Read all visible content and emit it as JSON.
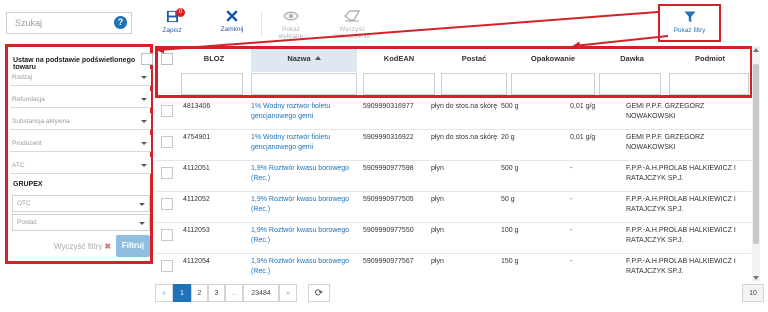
{
  "search": {
    "placeholder": "Szukaj",
    "help": "?"
  },
  "filter_panel": {
    "title": "Ustaw na podstawie podświetlonego towaru",
    "selects": [
      "Rodzaj",
      "Refundacja",
      "Substancja aktywna",
      "Producent",
      "ATC"
    ],
    "group_title": "GRUPEX",
    "group_selects": [
      "OTC",
      "Postać"
    ],
    "clear_label": "Wyczyść filtry",
    "clear_icon": "✖",
    "filter_label": "Filtruj"
  },
  "toolbar": {
    "save_label": "Zapisz",
    "save_badge": "0",
    "close_label": "Zamknij",
    "show_selected_label": "Pokaż wybrane",
    "clear_selection_label": "Wyczyść zaznaczenie",
    "show_filters_label": "Pokaż filtry"
  },
  "table": {
    "columns": [
      "BLOZ",
      "Nazwa",
      "KodEAN",
      "Postać",
      "Opakowanie",
      "Dawka",
      "Podmiot"
    ],
    "sorted_column": "Nazwa",
    "rows": [
      {
        "bloz": "4813406",
        "nazwa": "1% Wodny roztwór fioletu gencjanowego gemi",
        "ean": "5909990316977",
        "postac": "płyn do stos.na skórę",
        "opakowanie": "500 g",
        "dawka": "0,01 g/g",
        "podmiot": "GEMI P.P.F. GRZEGORZ NOWAKOWSKI"
      },
      {
        "bloz": "4754901",
        "nazwa": "1% Wodny roztwór fioletu gencjanowego gemi",
        "ean": "5909990316922",
        "postac": "płyn do stos.na skórę",
        "opakowanie": "20 g",
        "dawka": "0,01 g/g",
        "podmiot": "GEMI P.P.F. GRZEGORZ NOWAKOWSKI"
      },
      {
        "bloz": "4112051",
        "nazwa": "1,9% Roztwór kwasu borowego (Rec.)",
        "ean": "5909990977598",
        "postac": "płyn",
        "opakowanie": "500 g",
        "dawka": "-",
        "podmiot": "F.P.P.-A.H.PROLAB HALKIEWICZ I RATAJCZYK SP.J."
      },
      {
        "bloz": "4112052",
        "nazwa": "1,9% Roztwór kwasu borowego (Rec.)",
        "ean": "5909990977505",
        "postac": "płyn",
        "opakowanie": "50 g",
        "dawka": "-",
        "podmiot": "F.P.P.-A.H.PROLAB HALKIEWICZ I RATAJCZYK SP.J."
      },
      {
        "bloz": "4112053",
        "nazwa": "1,9% Roztwór kwasu borowego (Rec.)",
        "ean": "5909990977550",
        "postac": "płyn",
        "opakowanie": "100 g",
        "dawka": "-",
        "podmiot": "F.P.P.-A.H.PROLAB HALKIEWICZ I RATAJCZYK SP.J."
      },
      {
        "bloz": "4112054",
        "nazwa": "1,9% Roztwór kwasu borowego (Rec.)",
        "ean": "5909990977567",
        "postac": "płyn",
        "opakowanie": "150 g",
        "dawka": "-",
        "podmiot": "F.P.P.-A.H.PROLAB HALKIEWICZ I RATAJCZYK SP.J."
      }
    ]
  },
  "pagination": {
    "prev": "«",
    "pages": [
      "1",
      "2",
      "3",
      "...",
      "23484"
    ],
    "next": "»",
    "current": "1",
    "refresh_icon": "⟳",
    "page_size": "10"
  },
  "colors": {
    "accent": "#1e73b8",
    "highlight": "#d42026",
    "filter_button": "#8fbee0"
  },
  "icons": [
    "help-icon",
    "save-icon",
    "close-icon",
    "eye-icon",
    "eraser-icon",
    "filter-icon",
    "sort-asc-icon",
    "clear-x-icon",
    "refresh-icon"
  ]
}
